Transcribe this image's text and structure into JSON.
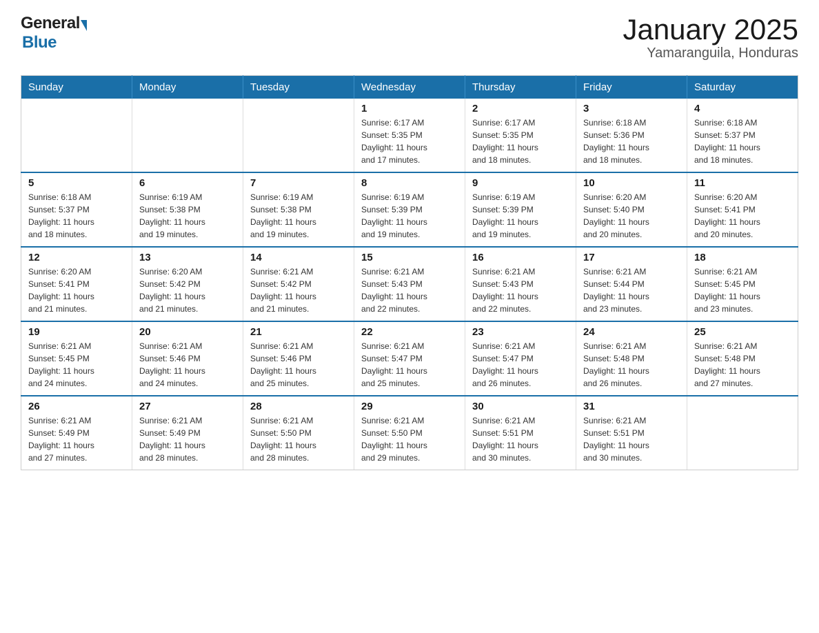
{
  "logo": {
    "general": "General",
    "blue": "Blue"
  },
  "title": "January 2025",
  "subtitle": "Yamaranguila, Honduras",
  "days_of_week": [
    "Sunday",
    "Monday",
    "Tuesday",
    "Wednesday",
    "Thursday",
    "Friday",
    "Saturday"
  ],
  "weeks": [
    [
      {
        "day": "",
        "info": ""
      },
      {
        "day": "",
        "info": ""
      },
      {
        "day": "",
        "info": ""
      },
      {
        "day": "1",
        "info": "Sunrise: 6:17 AM\nSunset: 5:35 PM\nDaylight: 11 hours\nand 17 minutes."
      },
      {
        "day": "2",
        "info": "Sunrise: 6:17 AM\nSunset: 5:35 PM\nDaylight: 11 hours\nand 18 minutes."
      },
      {
        "day": "3",
        "info": "Sunrise: 6:18 AM\nSunset: 5:36 PM\nDaylight: 11 hours\nand 18 minutes."
      },
      {
        "day": "4",
        "info": "Sunrise: 6:18 AM\nSunset: 5:37 PM\nDaylight: 11 hours\nand 18 minutes."
      }
    ],
    [
      {
        "day": "5",
        "info": "Sunrise: 6:18 AM\nSunset: 5:37 PM\nDaylight: 11 hours\nand 18 minutes."
      },
      {
        "day": "6",
        "info": "Sunrise: 6:19 AM\nSunset: 5:38 PM\nDaylight: 11 hours\nand 19 minutes."
      },
      {
        "day": "7",
        "info": "Sunrise: 6:19 AM\nSunset: 5:38 PM\nDaylight: 11 hours\nand 19 minutes."
      },
      {
        "day": "8",
        "info": "Sunrise: 6:19 AM\nSunset: 5:39 PM\nDaylight: 11 hours\nand 19 minutes."
      },
      {
        "day": "9",
        "info": "Sunrise: 6:19 AM\nSunset: 5:39 PM\nDaylight: 11 hours\nand 19 minutes."
      },
      {
        "day": "10",
        "info": "Sunrise: 6:20 AM\nSunset: 5:40 PM\nDaylight: 11 hours\nand 20 minutes."
      },
      {
        "day": "11",
        "info": "Sunrise: 6:20 AM\nSunset: 5:41 PM\nDaylight: 11 hours\nand 20 minutes."
      }
    ],
    [
      {
        "day": "12",
        "info": "Sunrise: 6:20 AM\nSunset: 5:41 PM\nDaylight: 11 hours\nand 21 minutes."
      },
      {
        "day": "13",
        "info": "Sunrise: 6:20 AM\nSunset: 5:42 PM\nDaylight: 11 hours\nand 21 minutes."
      },
      {
        "day": "14",
        "info": "Sunrise: 6:21 AM\nSunset: 5:42 PM\nDaylight: 11 hours\nand 21 minutes."
      },
      {
        "day": "15",
        "info": "Sunrise: 6:21 AM\nSunset: 5:43 PM\nDaylight: 11 hours\nand 22 minutes."
      },
      {
        "day": "16",
        "info": "Sunrise: 6:21 AM\nSunset: 5:43 PM\nDaylight: 11 hours\nand 22 minutes."
      },
      {
        "day": "17",
        "info": "Sunrise: 6:21 AM\nSunset: 5:44 PM\nDaylight: 11 hours\nand 23 minutes."
      },
      {
        "day": "18",
        "info": "Sunrise: 6:21 AM\nSunset: 5:45 PM\nDaylight: 11 hours\nand 23 minutes."
      }
    ],
    [
      {
        "day": "19",
        "info": "Sunrise: 6:21 AM\nSunset: 5:45 PM\nDaylight: 11 hours\nand 24 minutes."
      },
      {
        "day": "20",
        "info": "Sunrise: 6:21 AM\nSunset: 5:46 PM\nDaylight: 11 hours\nand 24 minutes."
      },
      {
        "day": "21",
        "info": "Sunrise: 6:21 AM\nSunset: 5:46 PM\nDaylight: 11 hours\nand 25 minutes."
      },
      {
        "day": "22",
        "info": "Sunrise: 6:21 AM\nSunset: 5:47 PM\nDaylight: 11 hours\nand 25 minutes."
      },
      {
        "day": "23",
        "info": "Sunrise: 6:21 AM\nSunset: 5:47 PM\nDaylight: 11 hours\nand 26 minutes."
      },
      {
        "day": "24",
        "info": "Sunrise: 6:21 AM\nSunset: 5:48 PM\nDaylight: 11 hours\nand 26 minutes."
      },
      {
        "day": "25",
        "info": "Sunrise: 6:21 AM\nSunset: 5:48 PM\nDaylight: 11 hours\nand 27 minutes."
      }
    ],
    [
      {
        "day": "26",
        "info": "Sunrise: 6:21 AM\nSunset: 5:49 PM\nDaylight: 11 hours\nand 27 minutes."
      },
      {
        "day": "27",
        "info": "Sunrise: 6:21 AM\nSunset: 5:49 PM\nDaylight: 11 hours\nand 28 minutes."
      },
      {
        "day": "28",
        "info": "Sunrise: 6:21 AM\nSunset: 5:50 PM\nDaylight: 11 hours\nand 28 minutes."
      },
      {
        "day": "29",
        "info": "Sunrise: 6:21 AM\nSunset: 5:50 PM\nDaylight: 11 hours\nand 29 minutes."
      },
      {
        "day": "30",
        "info": "Sunrise: 6:21 AM\nSunset: 5:51 PM\nDaylight: 11 hours\nand 30 minutes."
      },
      {
        "day": "31",
        "info": "Sunrise: 6:21 AM\nSunset: 5:51 PM\nDaylight: 11 hours\nand 30 minutes."
      },
      {
        "day": "",
        "info": ""
      }
    ]
  ]
}
